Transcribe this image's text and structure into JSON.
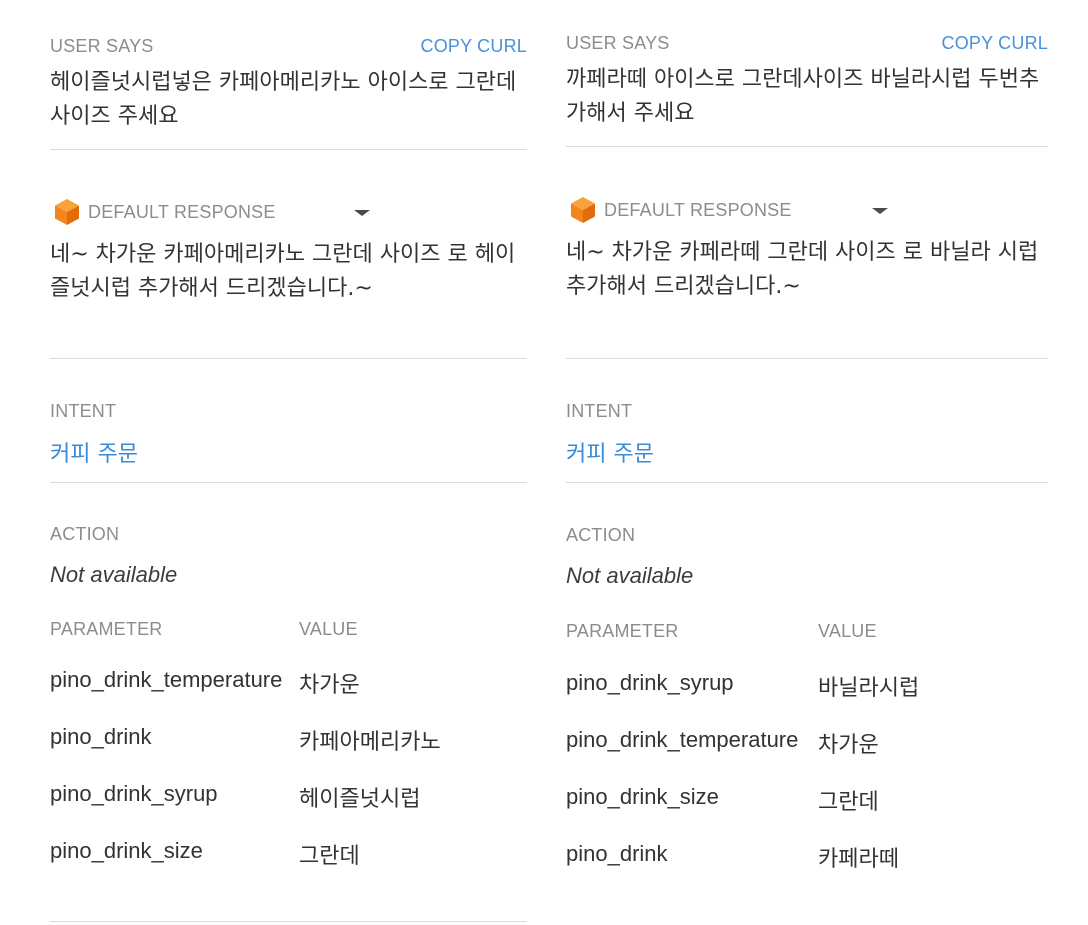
{
  "panels": [
    {
      "user_says_label": "USER SAYS",
      "copy_curl_label": "COPY CURL",
      "user_says_text": "헤이즐넛시럽넣은 카페아메리카노 아이스로 그란데사이즈 주세요",
      "default_response_label": "DEFAULT RESPONSE",
      "default_response_text": "네~ 차가운 카페아메리카노 그란데 사이즈 로 헤이즐넛시럽 추가해서 드리겠습니다.~",
      "intent_label": "INTENT",
      "intent_value": "커피 주문",
      "action_label": "ACTION",
      "action_value": "Not available",
      "parameter_header": "PARAMETER",
      "value_header": "VALUE",
      "parameters": [
        {
          "name": "pino_drink_temperature",
          "value": "차가운"
        },
        {
          "name": "pino_drink",
          "value": "카페아메리카노"
        },
        {
          "name": "pino_drink_syrup",
          "value": "헤이즐넛시럽"
        },
        {
          "name": "pino_drink_size",
          "value": "그란데"
        }
      ]
    },
    {
      "user_says_label": "USER SAYS",
      "copy_curl_label": "COPY CURL",
      "user_says_text": "까페라떼 아이스로 그란데사이즈 바닐라시럽 두번추가해서 주세요",
      "default_response_label": "DEFAULT RESPONSE",
      "default_response_text": "네~ 차가운 카페라떼 그란데 사이즈 로 바닐라 시럽 추가해서 드리겠습니다.~",
      "intent_label": "INTENT",
      "intent_value": "커피 주문",
      "action_label": "ACTION",
      "action_value": "Not available",
      "parameter_header": "PARAMETER",
      "value_header": "VALUE",
      "parameters": [
        {
          "name": "pino_drink_syrup",
          "value": "바닐라시럽"
        },
        {
          "name": "pino_drink_temperature",
          "value": "차가운"
        },
        {
          "name": "pino_drink_size",
          "value": "그란데"
        },
        {
          "name": "pino_drink",
          "value": "카페라떼"
        }
      ]
    }
  ],
  "icons": {
    "response_icon": "dialogflow-cube-icon",
    "dropdown_icon": "caret-down-icon",
    "accent_color": "#f5841f"
  }
}
